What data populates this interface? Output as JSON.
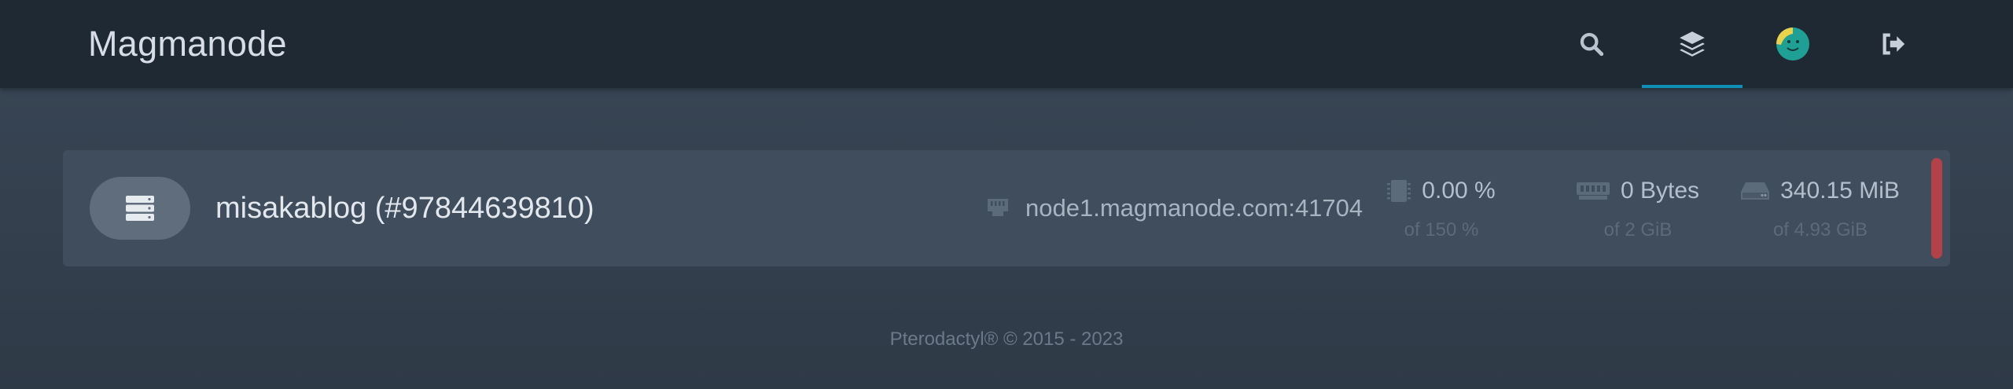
{
  "header": {
    "brand": "Magmanode",
    "nav": [
      {
        "name": "search",
        "icon": "search-icon",
        "active": false
      },
      {
        "name": "servers",
        "icon": "layers-icon",
        "active": true
      },
      {
        "name": "account",
        "icon": "avatar-icon",
        "active": false
      },
      {
        "name": "logout",
        "icon": "logout-icon",
        "active": false
      }
    ],
    "accent_color": "#0e8fb5"
  },
  "servers": [
    {
      "name": "misakablog (#97844639810)",
      "allocation": "node1.magmanode.com:41704",
      "cpu": {
        "value": "0.00 %",
        "limit": "of 150 %"
      },
      "memory": {
        "value": "0 Bytes",
        "limit": "of 2 GiB"
      },
      "disk": {
        "value": "340.15 MiB",
        "limit": "of 4.93 GiB"
      },
      "status_color": "#b2414a"
    }
  ],
  "footer": {
    "text": "Pterodactyl® © 2015 - 2023"
  }
}
